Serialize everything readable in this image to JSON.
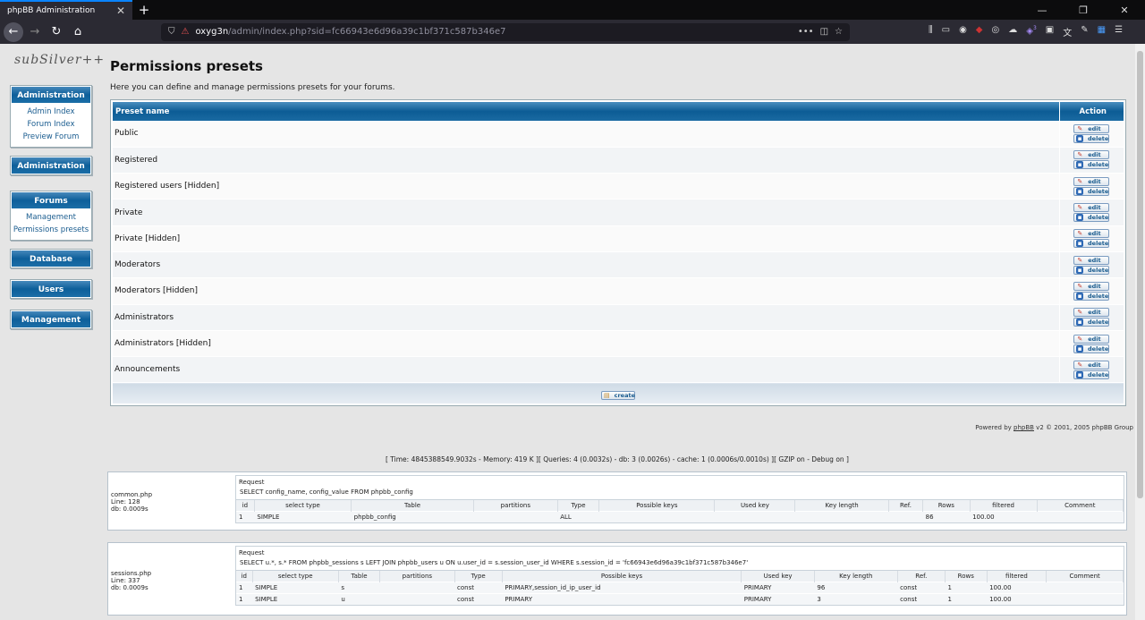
{
  "browser": {
    "tab_title": "phpBB Administration",
    "url_host": "oxyg3n",
    "url_path": "/admin/index.php?sid=fc66943e6d96a39c1bf371c587b346e7",
    "ext_badge": "3"
  },
  "sidebar": {
    "logo": "subSilver++",
    "boxes": [
      {
        "title": "Administration",
        "links": [
          "Admin Index",
          "Forum Index",
          "Preview Forum"
        ]
      },
      {
        "title": "Administration",
        "links": []
      },
      {
        "title": "Forums",
        "links": [
          "Management",
          "Permissions presets"
        ]
      },
      {
        "title": "Database",
        "links": []
      },
      {
        "title": "Users",
        "links": []
      },
      {
        "title": "Management",
        "links": []
      }
    ]
  },
  "main": {
    "title": "Permissions presets",
    "description": "Here you can define and manage permissions presets for your forums.",
    "col_name": "Preset name",
    "col_action": "Action",
    "edit_label": "edit",
    "delete_label": "delete",
    "create_label": "create",
    "presets": [
      "Public",
      "Registered",
      "Registered users [Hidden]",
      "Private",
      "Private [Hidden]",
      "Moderators",
      "Moderators [Hidden]",
      "Administrators",
      "Administrators [Hidden]",
      "Announcements"
    ]
  },
  "footer": {
    "powered_pre": "Powered by ",
    "powered_link": "phpBB",
    "powered_post": " v2 © 2001, 2005 phpBB Group",
    "debug": "[ Time: 4845388549.9032s - Memory: 419 K ][ Queries: 4 (0.0032s) - db: 3 (0.0026s) - cache: 1 (0.0006s/0.0010s) ][ GZIP on - Debug on ]"
  },
  "queries": [
    {
      "file": "common.php",
      "line": "Line: 128",
      "db": "db: 0.0009s",
      "request_label": "Request",
      "sql": "SELECT config_name, config_value FROM phpbb_config",
      "columns": [
        "id",
        "select type",
        "Table",
        "partitions",
        "Type",
        "Possible keys",
        "Used key",
        "Key length",
        "Ref.",
        "Rows",
        "filtered",
        "Comment"
      ],
      "rows": [
        [
          "1",
          "SIMPLE",
          "phpbb_config",
          "",
          "ALL",
          "",
          "",
          "",
          "",
          "86",
          "100.00",
          ""
        ]
      ]
    },
    {
      "file": "sessions.php",
      "line": "Line: 337",
      "db": "db: 0.0009s",
      "request_label": "Request",
      "sql": "SELECT u.*, s.* FROM phpbb_sessions s LEFT JOIN phpbb_users u ON u.user_id = s.session_user_id WHERE s.session_id = 'fc66943e6d96a39c1bf371c587b346e7'",
      "columns": [
        "id",
        "select type",
        "Table",
        "partitions",
        "Type",
        "Possible keys",
        "Used key",
        "Key length",
        "Ref.",
        "Rows",
        "filtered",
        "Comment"
      ],
      "rows": [
        [
          "1",
          "SIMPLE",
          "s",
          "",
          "const",
          "PRIMARY,session_id_ip_user_id",
          "PRIMARY",
          "96",
          "const",
          "1",
          "100.00",
          ""
        ],
        [
          "1",
          "SIMPLE",
          "u",
          "",
          "const",
          "PRIMARY",
          "PRIMARY",
          "3",
          "const",
          "1",
          "100.00",
          ""
        ]
      ]
    }
  ]
}
